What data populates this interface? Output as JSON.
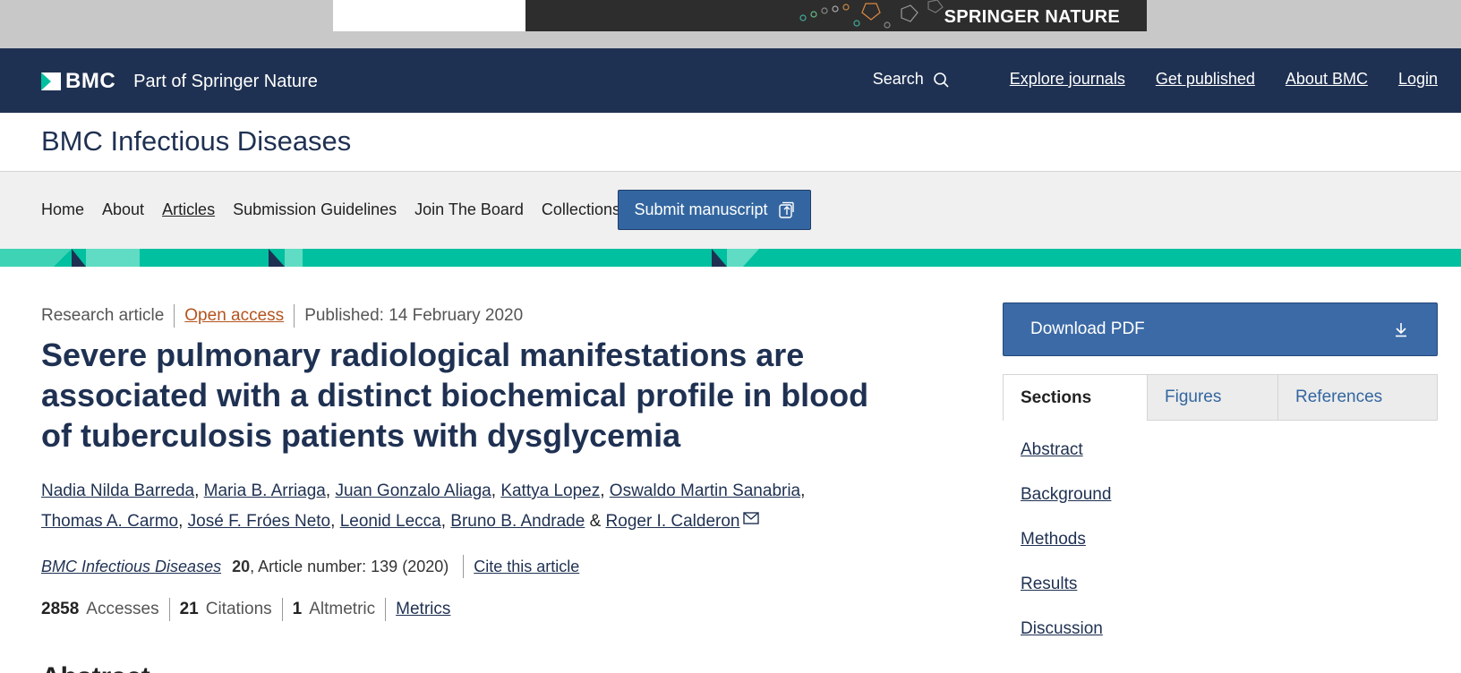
{
  "ad": {
    "brand": "SPRINGER NATURE"
  },
  "topnav": {
    "logo": "BMC",
    "logo_sub": "Part of Springer Nature",
    "search_label": "Search",
    "links": [
      "Explore journals",
      "Get published",
      "About BMC",
      "Login"
    ]
  },
  "journal": {
    "title": "BMC Infectious Diseases"
  },
  "journal_nav": {
    "items": [
      "Home",
      "About",
      "Articles",
      "Submission Guidelines",
      "Join The Board",
      "Collections"
    ],
    "submit_label": "Submit manuscript"
  },
  "article": {
    "type": "Research article",
    "access": "Open access",
    "published": "Published: 14 February 2020",
    "title": "Severe pulmonary radiological manifestations are associated with a distinct biochemical profile in blood of tuberculosis patients with dysglycemia",
    "authors": [
      "Nadia Nilda Barreda",
      "Maria B. Arriaga",
      "Juan Gonzalo Aliaga",
      "Kattya Lopez",
      "Oswaldo Martin Sanabria",
      "Thomas A. Carmo",
      "José F. Fróes Neto",
      "Leonid Lecca",
      "Bruno B. Andrade",
      "Roger I. Calderon"
    ],
    "journal_name": "BMC Infectious Diseases",
    "volume": "20",
    "article_number": ", Article number: 139 (2020)",
    "cite_label": "Cite this article",
    "accesses_count": "2858",
    "accesses_label": "Accesses",
    "citations_count": "21",
    "citations_label": "Citations",
    "altmetric_count": "1",
    "altmetric_label": "Altmetric",
    "metrics_label": "Metrics",
    "abstract_heading": "Abstract"
  },
  "sidebar": {
    "download_label": "Download PDF",
    "tabs": [
      "Sections",
      "Figures",
      "References"
    ],
    "sections": [
      "Abstract",
      "Background",
      "Methods",
      "Results",
      "Discussion"
    ]
  },
  "colors": {
    "navy": "#1f3152",
    "teal": "#00c0a0",
    "button_blue": "#3366a0",
    "open_access": "#b3541e"
  }
}
